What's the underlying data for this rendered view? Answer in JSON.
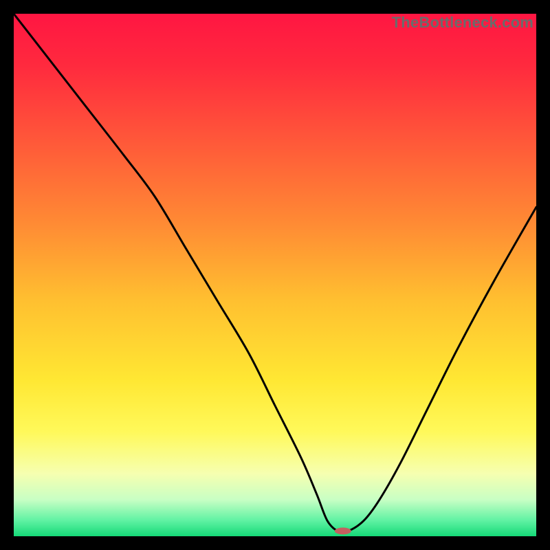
{
  "watermark_text": "TheBottleneck.com",
  "chart_data": {
    "type": "line",
    "title": "",
    "xlabel": "",
    "ylabel": "",
    "xlim": [
      0,
      100
    ],
    "ylim": [
      0,
      100
    ],
    "grid": false,
    "legend": false,
    "series": [
      {
        "name": "bottleneck-curve",
        "x": [
          0,
          7,
          14,
          21,
          27,
          33,
          39,
          45,
          50,
          55,
          58,
          60,
          62,
          64,
          67,
          70,
          74,
          79,
          85,
          92,
          100
        ],
        "values": [
          100,
          91,
          82,
          73,
          65,
          55,
          45,
          35,
          25,
          15,
          8,
          3,
          1,
          1,
          3,
          7,
          14,
          24,
          36,
          49,
          63
        ]
      }
    ],
    "marker": {
      "name": "optimal-point",
      "x": 63,
      "y": 1,
      "color": "#c46060",
      "rx": 12,
      "ry": 5
    },
    "gradient_stops": [
      {
        "offset": 0.0,
        "color": "#ff1642"
      },
      {
        "offset": 0.1,
        "color": "#ff2a3e"
      },
      {
        "offset": 0.25,
        "color": "#ff5a39"
      },
      {
        "offset": 0.4,
        "color": "#ff8a34"
      },
      {
        "offset": 0.55,
        "color": "#ffc030"
      },
      {
        "offset": 0.7,
        "color": "#ffe733"
      },
      {
        "offset": 0.8,
        "color": "#fff95a"
      },
      {
        "offset": 0.88,
        "color": "#f6ffb0"
      },
      {
        "offset": 0.93,
        "color": "#c8ffc4"
      },
      {
        "offset": 0.97,
        "color": "#5ff2a3"
      },
      {
        "offset": 1.0,
        "color": "#15d977"
      }
    ]
  }
}
